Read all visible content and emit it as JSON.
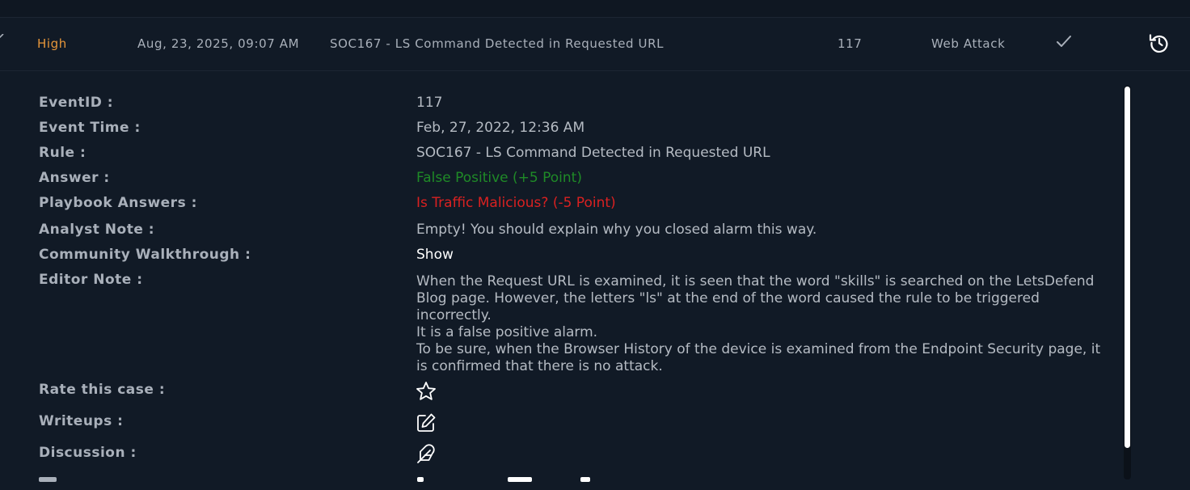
{
  "alert": {
    "severity": "High",
    "time": "Aug, 23, 2025, 09:07 AM",
    "rule": "SOC167 - LS Command Detected in Requested URL",
    "event_id": "117",
    "type": "Web Attack",
    "colors": {
      "severity": "#e6963a",
      "text": "#a9b0ba",
      "background": "#111a26"
    },
    "icons": [
      "chevron-up-icon",
      "check-icon",
      "revert-icon"
    ]
  },
  "details": {
    "event_id": {
      "label": "EventID :",
      "value": "117"
    },
    "event_time": {
      "label": "Event Time :",
      "value": "Feb, 27, 2022, 12:36 AM"
    },
    "rule": {
      "label": "Rule :",
      "value": "SOC167 - LS Command Detected in Requested URL"
    },
    "answer": {
      "label": "Answer :",
      "value": "False Positive (+5 Point)",
      "color": "#1f8a27"
    },
    "playbook": {
      "label": "Playbook Answers :",
      "value": "Is Traffic Malicious? (-5 Point)",
      "color": "#d92121"
    },
    "analyst_note": {
      "label": "Analyst Note :",
      "value": "Empty! You should explain why you closed alarm this way."
    },
    "walkthrough": {
      "label": "Community Walkthrough :",
      "value": "Show"
    },
    "editor_note": {
      "label": "Editor Note :",
      "lines": [
        "When the Request URL is examined, it is seen that the word \"skills\" is searched on the LetsDefend Blog page. However, the letters \"ls\" at the end of the word caused the rule to be triggered incorrectly.",
        "It is a false positive alarm.",
        "To be sure, when the Browser History of the device is examined from the Endpoint Security page, it is confirmed that there is no attack."
      ]
    },
    "rate": {
      "label": "Rate this case :",
      "icon": "star-icon"
    },
    "writeups": {
      "label": "Writeups :",
      "icon": "edit-icon"
    },
    "discussion": {
      "label": "Discussion :",
      "icon": "feather-icon"
    }
  }
}
